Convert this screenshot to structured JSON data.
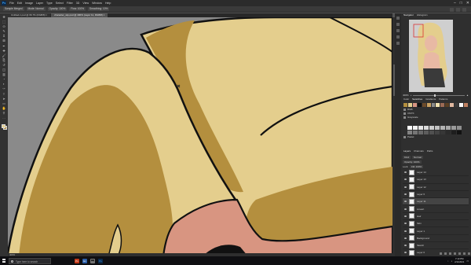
{
  "app": {
    "logo": "Ps",
    "menu": [
      "File",
      "Edit",
      "Image",
      "Layer",
      "Type",
      "Select",
      "Filter",
      "3D",
      "View",
      "Window",
      "Help"
    ],
    "window_controls": [
      "–",
      "□",
      "✕"
    ]
  },
  "options_bar": {
    "items": [
      "Sample Merged",
      "Mode: Normal",
      "Opacity: 100%",
      "Flow: 100%",
      "Smoothing: 10%"
    ]
  },
  "tabs": [
    {
      "label": "Untitled-1.psd @ 66.7% (RGB/8) ×",
      "active": false
    },
    {
      "label": "character_wip.psd @ 400% (Layer 11, RGB/8) ×",
      "active": true
    }
  ],
  "toolbar": {
    "tools": [
      "move-icon",
      "marquee-icon",
      "lasso-icon",
      "quick-select-icon",
      "crop-icon",
      "frame-icon",
      "eyedropper-icon",
      "healing-icon",
      "brush-icon",
      "stamp-icon",
      "history-brush-icon",
      "eraser-icon",
      "gradient-icon",
      "blur-icon",
      "dodge-icon",
      "pen-icon",
      "type-icon",
      "path-select-icon",
      "shape-icon",
      "hand-icon",
      "zoom-icon",
      "more-icon"
    ],
    "glyphs": [
      "✥",
      "⬚",
      "ʘ",
      "✎",
      "⌗",
      "⊠",
      "✒",
      "✚",
      "🖌",
      "⎘",
      "↺",
      "◫",
      "▥",
      "◔",
      "◐",
      "✑",
      "T",
      "➤",
      "▭",
      "✋",
      "⚲",
      "…"
    ],
    "foreground_color": "#e3ce8c",
    "background_color": "#b48e3f"
  },
  "status": {
    "text": "400%"
  },
  "panels": {
    "navigator_tabs": [
      "Navigator",
      "Histogram"
    ],
    "zoom": "400%",
    "swatches_tabs": [
      "Color",
      "Swatches",
      "Gradients",
      "Patterns"
    ],
    "swatch_folders": [
      "RGB",
      "CMYK",
      "Grayscale",
      "Pastel"
    ],
    "layers_tabs": [
      "Layers",
      "Channels",
      "Paths"
    ],
    "layer_kind": "Kind",
    "blend_mode": "Normal",
    "opacity": "Opacity: 100%",
    "lock": "Lock:",
    "fill": "Fill: 100%",
    "layers": [
      {
        "name": "Layer 14",
        "active": false
      },
      {
        "name": "Layer 13",
        "active": false
      },
      {
        "name": "Layer 12",
        "active": false
      },
      {
        "name": "Layer 6",
        "active": false
      },
      {
        "name": "Layer 11",
        "active": true
      },
      {
        "name": "Lineart",
        "active": false
      },
      {
        "name": "Hair",
        "active": false
      },
      {
        "name": "Skin",
        "active": false
      },
      {
        "name": "Layer 1",
        "active": false
      },
      {
        "name": "Background",
        "active": false
      },
      {
        "name": "Sketch",
        "active": false
      },
      {
        "name": "Layer 0",
        "active": false
      }
    ]
  },
  "taskbar": {
    "search_placeholder": "Type here to search",
    "apps": [
      "Ps",
      "Ex",
      "Ch",
      "Ps"
    ],
    "time": "7:13 PM",
    "date": "2/11/2021"
  },
  "colors": {
    "hair_light": "#e4ce8d",
    "hair_dark": "#b48f3e",
    "skin": "#d89581",
    "canvas_bg": "#8a8a8a",
    "outline": "#111111"
  }
}
